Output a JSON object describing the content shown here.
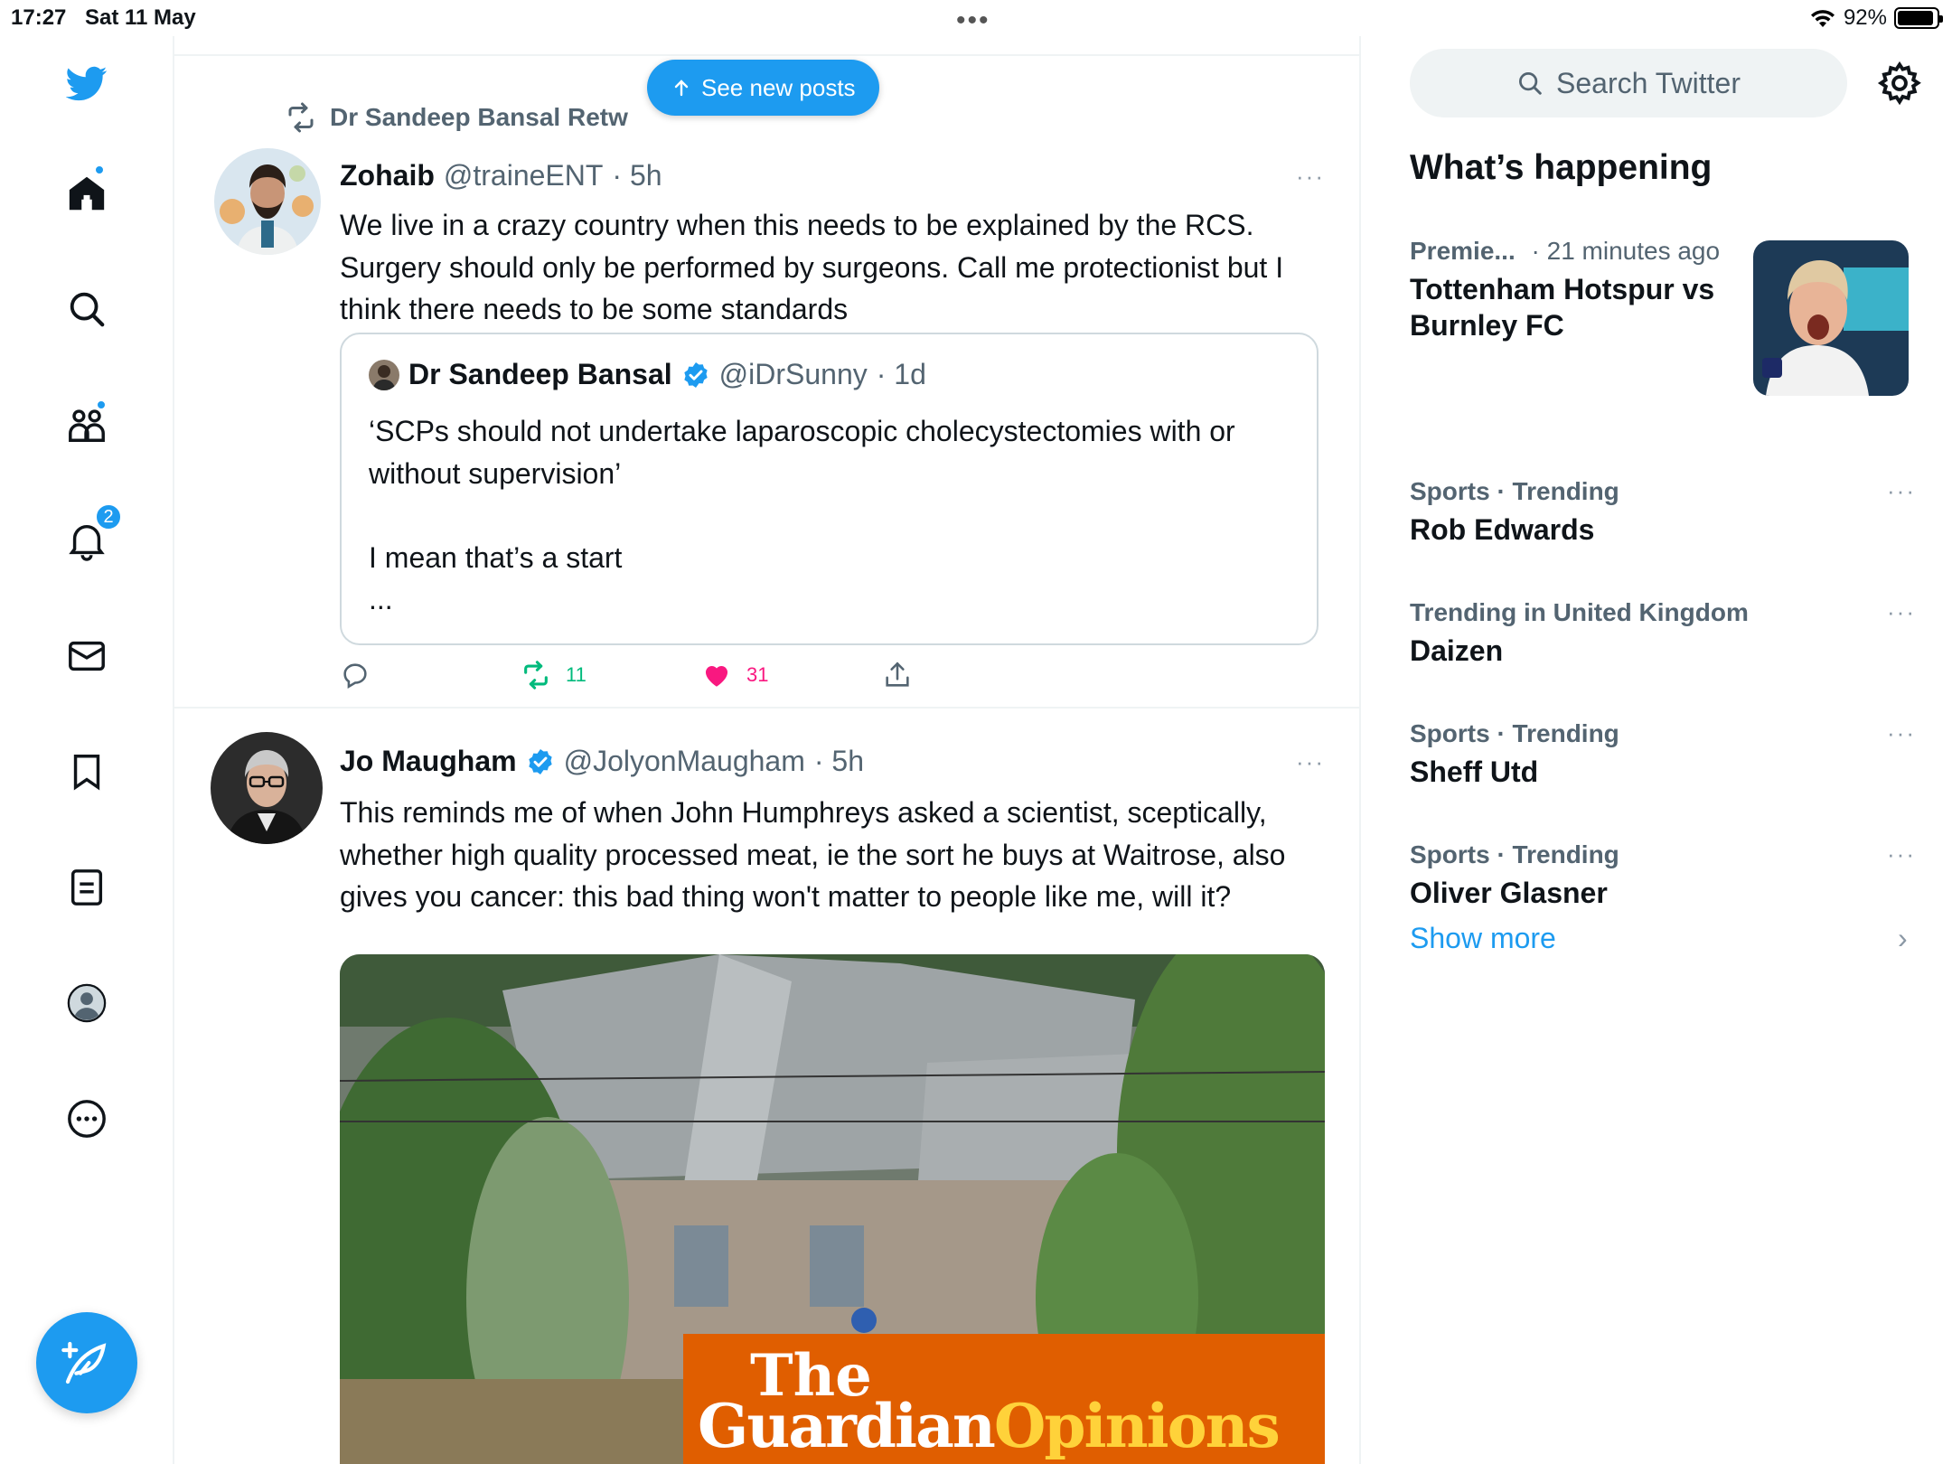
{
  "status_bar": {
    "time": "17:27",
    "date": "Sat 11 May",
    "battery": "92%",
    "battery_level": 0.92
  },
  "colors": {
    "accent": "#1d9bf0",
    "like": "#f91880",
    "retweet": "#00ba7c",
    "muted": "#536471"
  },
  "sidebar": {
    "items": [
      {
        "name": "twitter-logo-icon"
      },
      {
        "name": "home-icon",
        "has_dot": true
      },
      {
        "name": "search-icon"
      },
      {
        "name": "communities-icon",
        "has_dot": true
      },
      {
        "name": "notifications-icon",
        "badge": "2"
      },
      {
        "name": "messages-icon"
      },
      {
        "name": "bookmarks-icon"
      },
      {
        "name": "lists-icon"
      },
      {
        "name": "profile-icon"
      },
      {
        "name": "more-icon"
      }
    ],
    "compose_icon": "compose-feather-icon"
  },
  "timeline": {
    "see_new_posts": "See new posts",
    "tweets": [
      {
        "retweeted_by": "Dr Sandeep Bansal Retw",
        "name": "Zohaib",
        "handle": "@traineENT",
        "time": "· 5h",
        "more": "···",
        "text": "We live in a crazy country when this needs to be explained by the RCS. Surgery should only be performed by surgeons. Call me protectionist but I think there needs to be some standards",
        "quote": {
          "name": "Dr Sandeep Bansal",
          "handle": "@iDrSunny",
          "time": "· 1d",
          "text": "‘SCPs should not undertake laparoscopic cholecystectomies with or without supervision’\n\nI mean that’s a start\n..."
        },
        "actions": {
          "reply_count": "",
          "retweet_count": "11",
          "like_count": "31",
          "retweeted": true,
          "liked": true
        }
      },
      {
        "name": "Jo Maugham",
        "handle": "@JolyonMaugham",
        "time": "· 5h",
        "more": "···",
        "verified": true,
        "text": "This reminds me of when John Humphreys asked a scientist, sceptically, whether high quality processed meat, ie the sort he buys at Waitrose, also gives you cancer: this bad thing won't matter to people like me, will it?",
        "image_banner": {
          "the": "The",
          "guardian": "Guardian",
          "opinions": "Opinions"
        }
      }
    ]
  },
  "right_column": {
    "search_placeholder": "Search Twitter",
    "whats_happening": "What’s happening",
    "trends": [
      {
        "meta": "Premie...",
        "meta_time": "· 21 minutes ago",
        "title": "Tottenham Hotspur vs Burnley FC",
        "has_image": true
      },
      {
        "meta": "Sports · Trending",
        "title": "Rob Edwards",
        "more": "···"
      },
      {
        "meta": "Trending in United Kingdom",
        "title": "Daizen",
        "more": "···"
      },
      {
        "meta": "Sports · Trending",
        "title": "Sheff Utd",
        "more": "···"
      },
      {
        "meta": "Sports · Trending",
        "title": "Oliver Glasner",
        "more": "···"
      }
    ],
    "show_more": "Show more"
  }
}
